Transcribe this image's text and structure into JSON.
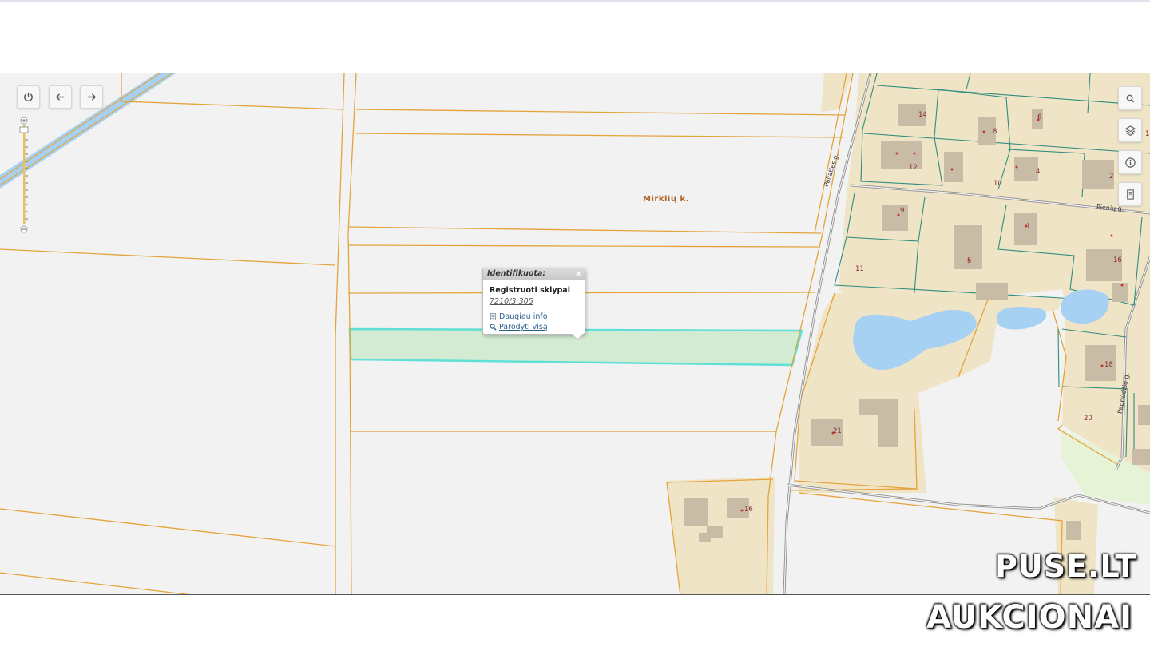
{
  "map": {
    "place_label": "Mirklių k.",
    "streets": [
      "Paliaties g.",
      "Pienių g.",
      "Papriūdžio g."
    ],
    "house_numbers": [
      "14",
      "8",
      "6",
      "1",
      "12",
      "10",
      "4",
      "2",
      "9",
      "1",
      "11",
      "5",
      "16",
      "18",
      "20",
      "21",
      "16"
    ],
    "colors": {
      "background": "#f2f2f2",
      "parcel_border": "#e5a33a",
      "residential_fill": "#f0e4c6",
      "water": "#a7d1f3",
      "building": "#c9bca6",
      "road": "#8f8f8f",
      "selected_fill": "#d2ebd2",
      "selected_border": "#5fe0d6",
      "teal_lines": "#2e8d7e"
    }
  },
  "controls": {
    "power_icon": "power-icon",
    "back_icon": "arrow-left-icon",
    "forward_icon": "arrow-right-icon",
    "zoom_in_icon": "plus-icon",
    "zoom_out_icon": "minus-icon",
    "right_tools": [
      "search-icon",
      "layers-icon",
      "info-icon",
      "legend-icon"
    ]
  },
  "popup": {
    "title": "Identifikuota:",
    "close": "×",
    "layer": "Registruoti sklypai",
    "parcel_id": "7210/3:305",
    "more_info": "Daugiau info",
    "show_all": "Parodyti visą"
  },
  "watermark": {
    "line1": "PUSE.LT",
    "line2": "AUKCIONAI"
  }
}
